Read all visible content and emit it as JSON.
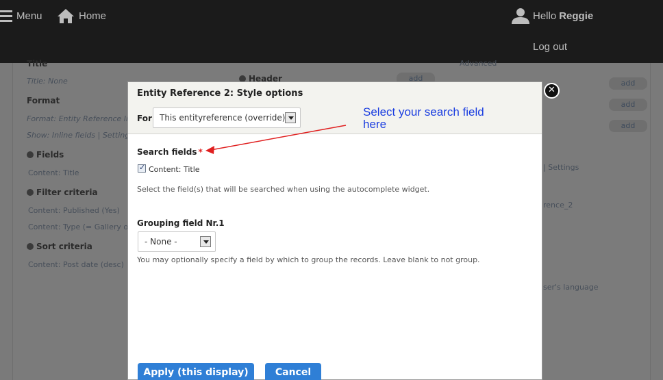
{
  "toolbar": {
    "menu_label": "Menu",
    "home_label": "Home",
    "hello_prefix": "Hello",
    "username": "Reggie",
    "logout_label": "Log out"
  },
  "background": {
    "title_head": "Title",
    "title_value_label": "Title:",
    "title_value": "None",
    "format_head": "Format",
    "format_label": "Format:",
    "format_value": "Entity Reference list",
    "show_label": "Show:",
    "show_value": "Inline fields",
    "show_sep": "|",
    "show_settings": "Settings",
    "fields_head": "Fields",
    "fields_item": "Content: Title",
    "filter_head": "Filter criteria",
    "filter_item1": "Content: Published (Yes)",
    "filter_item2": "Content: Type (= Gallery of ph",
    "sort_head": "Sort criteria",
    "sort_item": "Content: Post date (desc)",
    "header_head": "Header",
    "advanced_label": "Advanced",
    "add_label": "add",
    "settings_label": "Settings",
    "ref_partial": "rence_2",
    "lang_partial": "ser's language"
  },
  "modal": {
    "title": "Entity Reference 2: Style options",
    "for_label": "For",
    "for_value": "This entityreference (override)",
    "search_fields_label": "Search fields",
    "required_marker": "*",
    "checkbox_label": "Content: Title",
    "search_description": "Select the field(s) that will be searched when using the autocomplete widget.",
    "grouping_label": "Grouping field Nr.1",
    "grouping_value": "- None -",
    "grouping_description": "You may optionally specify a field by which to group the records. Leave blank to not group.",
    "apply_label": "Apply (this display)",
    "cancel_label": "Cancel",
    "close_glyph": "✕"
  },
  "annotation": {
    "line1": "Select your search field",
    "line2": "here"
  },
  "colors": {
    "toolbar_bg": "#1b1b1b",
    "overlay_bg": "#7a7a7a",
    "button_blue": "#2f7fd6",
    "annotation_blue": "#1a3de0",
    "arrow_red": "#e02020",
    "required_red": "#d22222"
  },
  "icons": {
    "menu": "hamburger-icon",
    "home": "home-icon",
    "user": "user-icon",
    "close": "close-icon",
    "help": "question-circle-icon"
  }
}
